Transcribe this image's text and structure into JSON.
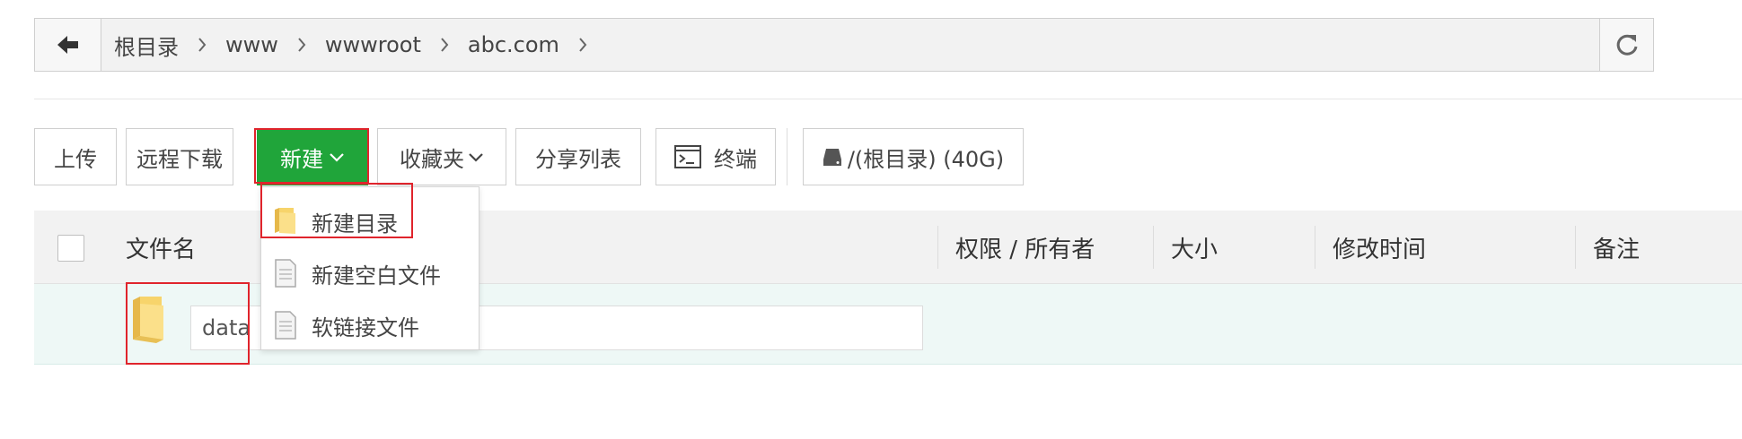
{
  "path_bar": {
    "crumbs": [
      "根目录",
      "www",
      "wwwroot",
      "abc.com"
    ]
  },
  "toolbar": {
    "upload_label": "上传",
    "remote_download_label": "远程下载",
    "new_label": "新建",
    "favorites_label": "收藏夹",
    "share_list_label": "分享列表",
    "terminal_label": "终端",
    "disk_label": "/(根目录) (40G)"
  },
  "new_menu": {
    "items": [
      {
        "label": "新建目录",
        "icon": "folder-icon"
      },
      {
        "label": "新建空白文件",
        "icon": "file-icon"
      },
      {
        "label": "软链接文件",
        "icon": "link-file-icon"
      }
    ]
  },
  "table": {
    "headers": {
      "name": "文件名",
      "permission": "权限 / 所有者",
      "size": "大小",
      "modified": "修改时间",
      "note": "备注"
    },
    "new_row": {
      "input_value": "data"
    }
  },
  "colors": {
    "accent_green": "#20a53a",
    "highlight_red": "#e0242c",
    "row_highlight": "#eef8f6",
    "header_bg": "#f2f2f2"
  }
}
